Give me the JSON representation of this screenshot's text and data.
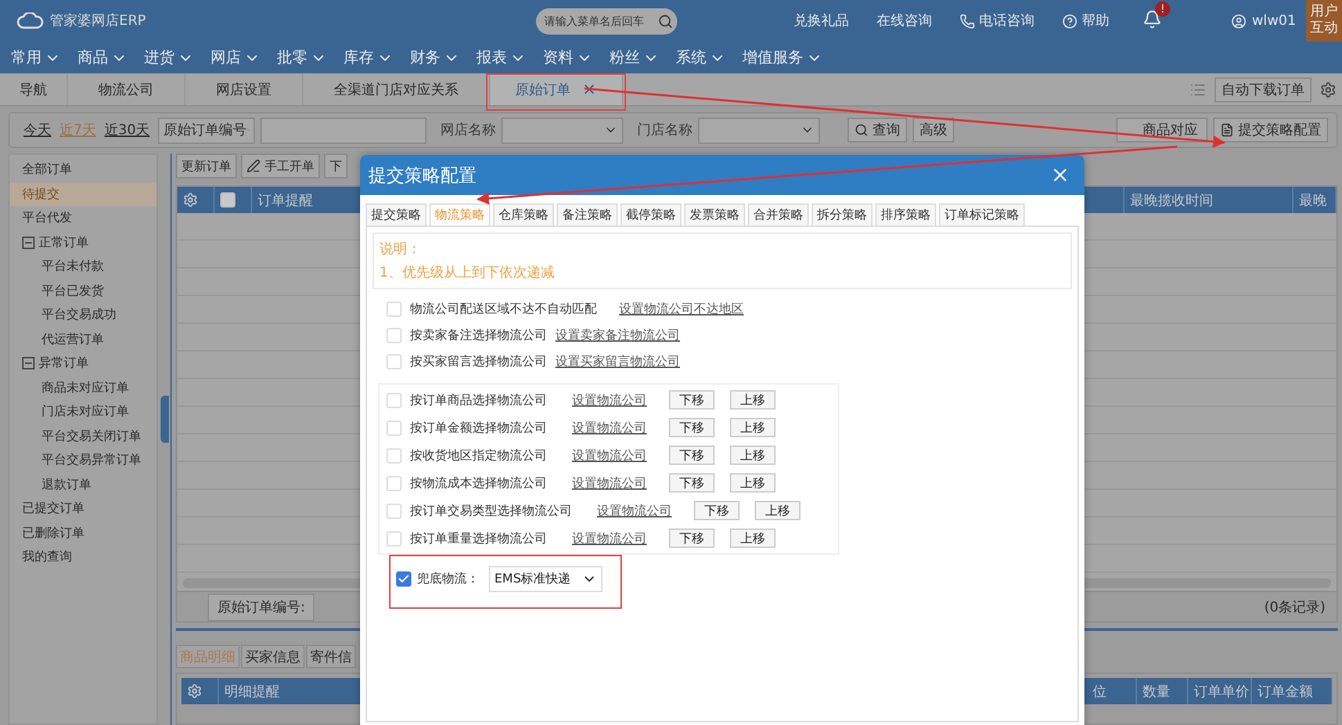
{
  "header": {
    "logo_text": "管家婆网店ERP",
    "search": {
      "placeholder": "请输入菜单名后回车"
    },
    "links": [
      {
        "kind": "text",
        "label": "兑换礼品"
      },
      {
        "kind": "text",
        "label": "在线咨询"
      },
      {
        "kind": "phone",
        "label": "电话咨询"
      },
      {
        "kind": "help",
        "label": "帮助"
      }
    ],
    "notification_badge": "!",
    "user": "wlw01",
    "side_badge": [
      "用户",
      "互动"
    ]
  },
  "menu": [
    "常用",
    "商品",
    "进货",
    "网店",
    "批零",
    "库存",
    "财务",
    "报表",
    "资料",
    "粉丝",
    "系统",
    "增值服务"
  ],
  "tabs": [
    {
      "label": "导航",
      "selected": false,
      "closable": false
    },
    {
      "label": "物流公司",
      "selected": false,
      "closable": false
    },
    {
      "label": "网店设置",
      "selected": false,
      "closable": false
    },
    {
      "label": "全渠道门店对应关系",
      "selected": false,
      "closable": false
    },
    {
      "label": "原始订单",
      "selected": true,
      "closable": true
    }
  ],
  "tab_bar_action": "自动下载订单",
  "filter": {
    "dates": [
      {
        "label": "今天",
        "selected": false
      },
      {
        "label": "近7天",
        "selected": true
      },
      {
        "label": "近30天",
        "selected": false
      }
    ],
    "field_select": "原始订单编号",
    "shop_label": "网店名称",
    "store_label": "门店名称",
    "search_button": "查询",
    "advanced_button": "高级",
    "match_button": "商品对应",
    "strategy_button": "提交策略配置"
  },
  "sidebar": [
    {
      "label": "全部订单",
      "selected": false
    },
    {
      "label": "待提交",
      "selected": true
    },
    {
      "label": "平台代发",
      "selected": false
    },
    {
      "label": "正常订单",
      "selected": false,
      "expanded": true,
      "children": [
        {
          "label": "平台未付款",
          "selected": false
        },
        {
          "label": "平台已发货",
          "selected": false
        },
        {
          "label": "平台交易成功",
          "selected": false
        },
        {
          "label": "代运营订单",
          "selected": false
        }
      ]
    },
    {
      "label": "异常订单",
      "selected": false,
      "expanded": true,
      "children": [
        {
          "label": "商品未对应订单",
          "selected": false
        },
        {
          "label": "门店未对应订单",
          "selected": false
        },
        {
          "label": "平台交易关闭订单",
          "selected": false
        },
        {
          "label": "平台交易异常订单",
          "selected": false
        },
        {
          "label": "退款订单",
          "selected": false
        }
      ]
    },
    {
      "label": "已提交订单",
      "selected": false
    },
    {
      "label": "已删除订单",
      "selected": false
    },
    {
      "label": "我的查询",
      "selected": false
    }
  ],
  "toolbar": [
    {
      "kind": "plain",
      "label": "更新订单"
    },
    {
      "kind": "edit",
      "label": "手工开单"
    },
    {
      "kind": "plain",
      "label": "下"
    }
  ],
  "table": {
    "header_checkbox": {
      "checked": false
    },
    "columns": [
      "订单提醒",
      "",
      "最晚揽收时间",
      "最晚"
    ],
    "footer_label": "原始订单编号:",
    "record_count": "(0条记录)"
  },
  "detail": {
    "tabs": [
      {
        "label": "商品明细",
        "selected": true
      },
      {
        "label": "买家信息",
        "selected": false
      },
      {
        "label": "寄件信",
        "selected": false
      }
    ],
    "columns": [
      "明细提醒",
      "位",
      "数量",
      "订单单价",
      "订单金额"
    ]
  },
  "dialog": {
    "title": "提交策略配置",
    "tabs": [
      {
        "label": "提交策略",
        "selected": false
      },
      {
        "label": "物流策略",
        "selected": true
      },
      {
        "label": "仓库策略",
        "selected": false
      },
      {
        "label": "备注策略",
        "selected": false
      },
      {
        "label": "截停策略",
        "selected": false
      },
      {
        "label": "发票策略",
        "selected": false
      },
      {
        "label": "合并策略",
        "selected": false
      },
      {
        "label": "拆分策略",
        "selected": false
      },
      {
        "label": "排序策略",
        "selected": false
      },
      {
        "label": "订单标记策略",
        "selected": false
      }
    ],
    "note": {
      "title": "说明：",
      "lines": [
        "1、优先级从上到下依次递减"
      ]
    },
    "rules": [
      {
        "label": "物流公司配送区域不达不自动匹配",
        "link": "设置物流公司不达地区",
        "checked": false
      },
      {
        "label": "按卖家备注选择物流公司",
        "link": "设置卖家备注物流公司",
        "checked": false
      },
      {
        "label": "按买家留言选择物流公司",
        "link": "设置买家留言物流公司",
        "checked": false
      }
    ],
    "ordered_rules": [
      {
        "label": "按订单商品选择物流公司",
        "link": "设置物流公司",
        "checked": false,
        "buttons": [
          "下移",
          "上移"
        ]
      },
      {
        "label": "按订单金额选择物流公司",
        "link": "设置物流公司",
        "checked": false,
        "buttons": [
          "下移",
          "上移"
        ]
      },
      {
        "label": "按收货地区指定物流公司",
        "link": "设置物流公司",
        "checked": false,
        "buttons": [
          "下移",
          "上移"
        ]
      },
      {
        "label": "按物流成本选择物流公司",
        "link": "设置物流公司",
        "checked": false,
        "buttons": [
          "下移",
          "上移"
        ]
      },
      {
        "label": "按订单交易类型选择物流公司",
        "link": "设置物流公司",
        "checked": false,
        "buttons": [
          "下移",
          "上移"
        ]
      },
      {
        "label": "按订单重量选择物流公司",
        "link": "设置物流公司",
        "checked": false,
        "buttons": [
          "下移",
          "上移"
        ]
      }
    ],
    "fallback": {
      "checked": true,
      "label": "兜底物流：",
      "value": "EMS标准快递"
    }
  }
}
